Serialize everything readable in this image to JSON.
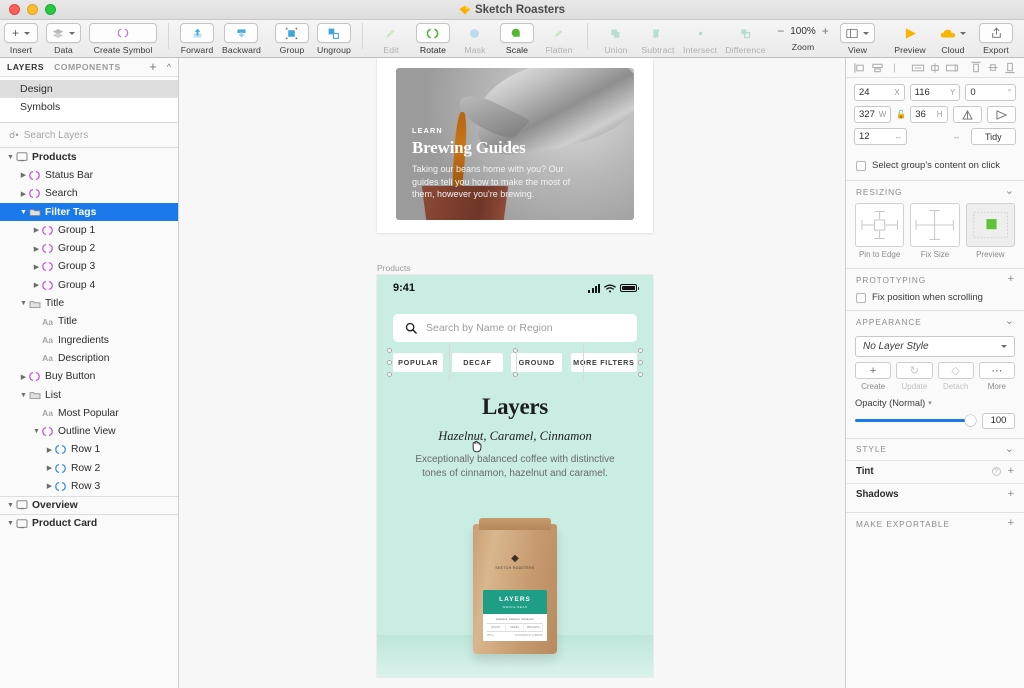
{
  "window": {
    "title": "Sketch Roasters",
    "doc_icon": "sketch-diamond-icon"
  },
  "toolbar": {
    "groups": [
      {
        "items": [
          {
            "label": "Insert",
            "icon": "plus-icon",
            "dropdown": true,
            "enabled": true
          },
          {
            "label": "Data",
            "icon": "stack-icon",
            "dropdown": true,
            "enabled": true
          },
          {
            "label": "Create Symbol",
            "icon": "symbol-icon",
            "dropdown": false,
            "enabled": true
          }
        ]
      },
      {
        "items": [
          {
            "label": "Forward",
            "icon": "bring-forward-icon",
            "enabled": true
          },
          {
            "label": "Backward",
            "icon": "send-backward-icon",
            "enabled": true
          },
          {
            "label": "Group",
            "icon": "group-icon",
            "enabled": true
          },
          {
            "label": "Ungroup",
            "icon": "ungroup-icon",
            "enabled": true
          }
        ]
      },
      {
        "items": [
          {
            "label": "Edit",
            "icon": "edit-icon",
            "enabled": false
          },
          {
            "label": "Rotate",
            "icon": "rotate-icon",
            "enabled": true
          },
          {
            "label": "Mask",
            "icon": "mask-icon",
            "enabled": false
          },
          {
            "label": "Scale",
            "icon": "scale-icon",
            "enabled": true
          },
          {
            "label": "Flatten",
            "icon": "flatten-icon",
            "enabled": false
          }
        ]
      },
      {
        "items": [
          {
            "label": "Union",
            "icon": "union-icon",
            "enabled": false
          },
          {
            "label": "Subtract",
            "icon": "subtract-icon",
            "enabled": false
          },
          {
            "label": "Intersect",
            "icon": "intersect-icon",
            "enabled": false
          },
          {
            "label": "Difference",
            "icon": "difference-icon",
            "enabled": false
          }
        ]
      },
      {
        "items": [
          {
            "label": "Zoom",
            "value": "100%",
            "minus": "−",
            "plus": "+"
          },
          {
            "label": "View",
            "icon": "view-icon",
            "dropdown": true
          },
          {
            "label": "Preview",
            "icon": "play-icon"
          },
          {
            "label": "Cloud",
            "icon": "cloud-icon",
            "dropdown": true
          },
          {
            "label": "Export",
            "icon": "export-icon"
          }
        ]
      }
    ]
  },
  "sidebar": {
    "tabs": [
      {
        "label": "LAYERS",
        "active": true
      },
      {
        "label": "COMPONENTS",
        "active": false
      }
    ],
    "add_icon": "plus-icon",
    "collapse_icon": "chevron-up-icon",
    "pages": [
      {
        "label": "Design",
        "selected": true
      },
      {
        "label": "Symbols",
        "selected": false
      }
    ],
    "search": {
      "placeholder": "Search Layers",
      "icon": "search-icon"
    },
    "layers": [
      {
        "label": "Products",
        "depth": 0,
        "icon": "artboard-icon",
        "disclosure": "open",
        "bold": true,
        "selected": false
      },
      {
        "label": "Status Bar",
        "depth": 1,
        "icon": "symbol-icon",
        "disclosure": "closed",
        "bold": false,
        "selected": false
      },
      {
        "label": "Search",
        "depth": 1,
        "icon": "symbol-icon",
        "disclosure": "closed",
        "bold": false,
        "selected": false
      },
      {
        "label": "Filter Tags",
        "depth": 1,
        "icon": "folder-icon",
        "disclosure": "open",
        "bold": true,
        "selected": true
      },
      {
        "label": "Group 1",
        "depth": 2,
        "icon": "symbol-icon",
        "disclosure": "closed",
        "bold": false,
        "selected": false
      },
      {
        "label": "Group 2",
        "depth": 2,
        "icon": "symbol-icon",
        "disclosure": "closed",
        "bold": false,
        "selected": false
      },
      {
        "label": "Group 3",
        "depth": 2,
        "icon": "symbol-icon",
        "disclosure": "closed",
        "bold": false,
        "selected": false
      },
      {
        "label": "Group 4",
        "depth": 2,
        "icon": "symbol-icon",
        "disclosure": "closed",
        "bold": false,
        "selected": false
      },
      {
        "label": "Title",
        "depth": 1,
        "icon": "folder-icon",
        "disclosure": "open",
        "bold": false,
        "selected": false
      },
      {
        "label": "Title",
        "depth": 2,
        "icon": "text-icon",
        "disclosure": "none",
        "bold": false,
        "selected": false
      },
      {
        "label": "Ingredients",
        "depth": 2,
        "icon": "text-icon",
        "disclosure": "none",
        "bold": false,
        "selected": false
      },
      {
        "label": "Description",
        "depth": 2,
        "icon": "text-icon",
        "disclosure": "none",
        "bold": false,
        "selected": false
      },
      {
        "label": "Buy Button",
        "depth": 1,
        "icon": "symbol-icon",
        "disclosure": "closed",
        "bold": false,
        "selected": false
      },
      {
        "label": "List",
        "depth": 1,
        "icon": "folder-icon",
        "disclosure": "open",
        "bold": false,
        "selected": false
      },
      {
        "label": "Most Popular",
        "depth": 2,
        "icon": "text-icon",
        "disclosure": "none",
        "bold": false,
        "selected": false
      },
      {
        "label": "Outline View",
        "depth": 2,
        "icon": "symbol-icon",
        "disclosure": "open",
        "bold": false,
        "selected": false
      },
      {
        "label": "Row 1",
        "depth": 3,
        "icon": "symbol-blue-icon",
        "disclosure": "closed",
        "bold": false,
        "selected": false
      },
      {
        "label": "Row 2",
        "depth": 3,
        "icon": "symbol-blue-icon",
        "disclosure": "closed",
        "bold": false,
        "selected": false
      },
      {
        "label": "Row 3",
        "depth": 3,
        "icon": "symbol-blue-icon",
        "disclosure": "closed",
        "bold": false,
        "selected": false
      },
      {
        "label": "Overview",
        "depth": 0,
        "icon": "artboard-icon",
        "disclosure": "open",
        "bold": true,
        "selected": false,
        "divider": true
      },
      {
        "label": "Product Card",
        "depth": 0,
        "icon": "artboard-icon",
        "disclosure": "open",
        "bold": true,
        "selected": false,
        "divider": true
      }
    ]
  },
  "canvas": {
    "learn_card": {
      "eyebrow": "LEARN",
      "title": "Brewing Guides",
      "body": "Taking our beans home with you? Our guides tell you how to make the most of them, however you're brewing."
    },
    "artboard_label": "Products",
    "mobile": {
      "status_time": "9:41",
      "signal_icon": "cellular-bars-icon",
      "wifi_icon": "wifi-icon",
      "battery_icon": "battery-icon",
      "search_placeholder": "Search by Name or Region",
      "search_icon": "search-icon",
      "tags": [
        "POPULAR",
        "DECAF",
        "GROUND",
        "MORE FILTERS"
      ],
      "product_title": "Layers",
      "product_subtitle": "Hazelnut, Caramel, Cinnamon",
      "product_description": "Exceptionally balanced coffee with distinctive tones of cinnamon, hazelnut and caramel.",
      "bag": {
        "brand": "SKETCH ROASTERS",
        "label_title": "LAYERS",
        "label_sub": "WHOLE BEAN",
        "label_note": "Hazelnut, Caramel, Cinnamon",
        "label_cells": [
          "ROAST",
          "ORIGIN",
          "PROCESS"
        ],
        "label_foot_left": "250 g",
        "label_foot_right": "ROASTED IN LONDON"
      }
    },
    "cursor_icon": "grab-hand-cursor"
  },
  "inspector": {
    "align_icons": [
      "align-left-icon",
      "align-center-horizontal-icon",
      "align-right-icon",
      "distribute-horizontal-icon",
      "align-center-vertical-icon",
      "distribute-vertical-icon",
      "align-top-icon",
      "align-middle-icon",
      "align-bottom-icon"
    ],
    "position": {
      "x": {
        "value": "24",
        "unit": "X"
      },
      "y": {
        "value": "116",
        "unit": "Y"
      },
      "rotation": {
        "value": "0",
        "unit": "°"
      },
      "w": {
        "value": "327",
        "unit": "W"
      },
      "h": {
        "value": "36",
        "unit": "H"
      },
      "lock_icon": "lock-icon",
      "flip_h_icon": "flip-horizontal-icon",
      "flip_v_icon": "flip-vertical-icon",
      "radius": {
        "value": "12",
        "unit": "↔"
      },
      "spacing": {
        "value": "",
        "unit": "↔"
      },
      "tidy_label": "Tidy"
    },
    "select_group_label": "Select group's content on click",
    "resizing": {
      "title": "RESIZING",
      "collapse_icon": "chevron-down-icon",
      "options": [
        {
          "label": "Pin to Edge",
          "icon": "pin-to-edge-icon",
          "active": false
        },
        {
          "label": "Fix Size",
          "icon": "fix-size-icon",
          "active": false
        },
        {
          "label": "Preview",
          "icon": "resize-preview-icon",
          "active": true
        }
      ]
    },
    "prototyping": {
      "title": "PROTOTYPING",
      "add_icon": "plus-icon",
      "fix_position_label": "Fix position when scrolling"
    },
    "appearance": {
      "title": "APPEARANCE",
      "collapse_icon": "chevron-down-icon",
      "style_value": "No Layer Style",
      "style_caret": "chevron-down-icon",
      "actions": [
        {
          "label": "Create",
          "icon": "plus-icon",
          "enabled": true
        },
        {
          "label": "Update",
          "icon": "refresh-icon",
          "enabled": false
        },
        {
          "label": "Detach",
          "icon": "detach-icon",
          "enabled": false
        },
        {
          "label": "More",
          "icon": "ellipsis-icon",
          "enabled": true
        }
      ],
      "opacity_label": "Opacity (Normal)",
      "opacity_value": "100",
      "opacity_percent": 100
    },
    "style": {
      "title": "STYLE",
      "collapse_icon": "chevron-down-icon",
      "rows": [
        {
          "label": "Tint",
          "help": true,
          "add_icon": "plus-icon"
        },
        {
          "label": "Shadows",
          "help": false,
          "add_icon": "plus-icon"
        }
      ]
    },
    "export": {
      "title": "MAKE EXPORTABLE",
      "add_icon": "plus-icon"
    }
  },
  "colors": {
    "accent_blue": "#1a7aeb",
    "mint": "#c9ece3",
    "teal_label": "#1f9e86",
    "sketch_yellow": "#f7b500"
  }
}
